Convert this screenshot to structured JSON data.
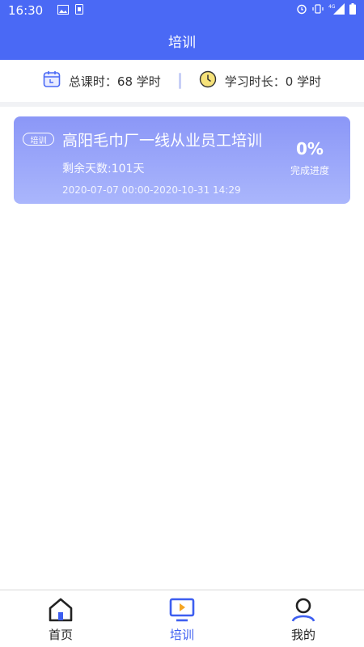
{
  "status_bar": {
    "time": "16:30",
    "network_label": "4G"
  },
  "app_bar": {
    "title": "培训"
  },
  "stats": {
    "total_hours": "总课时：68 学时",
    "study_time": "学习时长：0 学时"
  },
  "courses": [
    {
      "tag": "培训",
      "title": "高阳毛巾厂一线从业员工培训",
      "remaining": "剩余天数:101天",
      "dates": "2020-07-07 00:00-2020-10-31 14:29",
      "progress": "0%",
      "progress_label": "完成进度"
    }
  ],
  "bottom_nav": {
    "home": "首页",
    "training": "培训",
    "mine": "我的"
  },
  "colors": {
    "primary": "#4a69f5",
    "card_top": "#8b97f7",
    "card_bottom": "#aab6fc",
    "active": "#3d5ef0"
  }
}
